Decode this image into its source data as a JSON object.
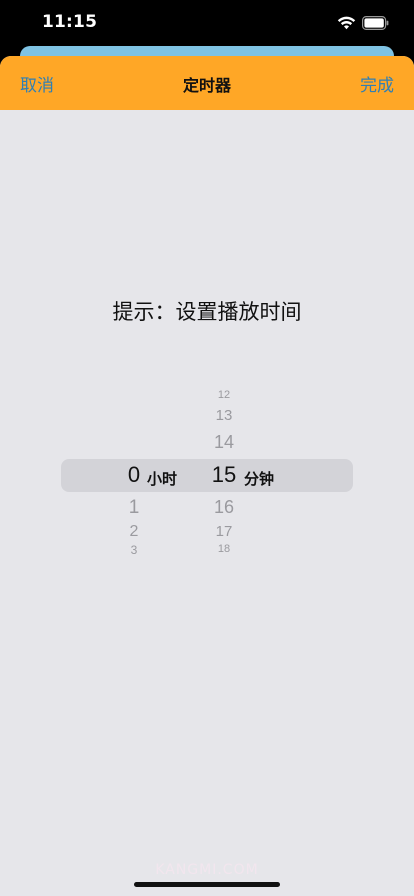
{
  "status_bar": {
    "time": "11:15",
    "icons": [
      "wifi-icon",
      "battery-icon"
    ]
  },
  "sheet": {
    "cancel_label": "取消",
    "title": "定时器",
    "done_label": "完成"
  },
  "hint": "提示：设置播放时间",
  "picker": {
    "hours": {
      "unit": "小时",
      "selected": "0",
      "below": [
        "1",
        "2",
        "3"
      ]
    },
    "minutes": {
      "unit": "分钟",
      "selected": "15",
      "above": [
        "12",
        "13",
        "14"
      ],
      "below": [
        "16",
        "17",
        "18"
      ]
    }
  },
  "watermark": "KANGMI.COM",
  "colors": {
    "header": "#ffa726",
    "action_text": "#2f7fb5",
    "sheet_background": "#e6e6ea",
    "picker_highlight": "#d3d3d8",
    "card_peek": "#7fc3e3"
  }
}
